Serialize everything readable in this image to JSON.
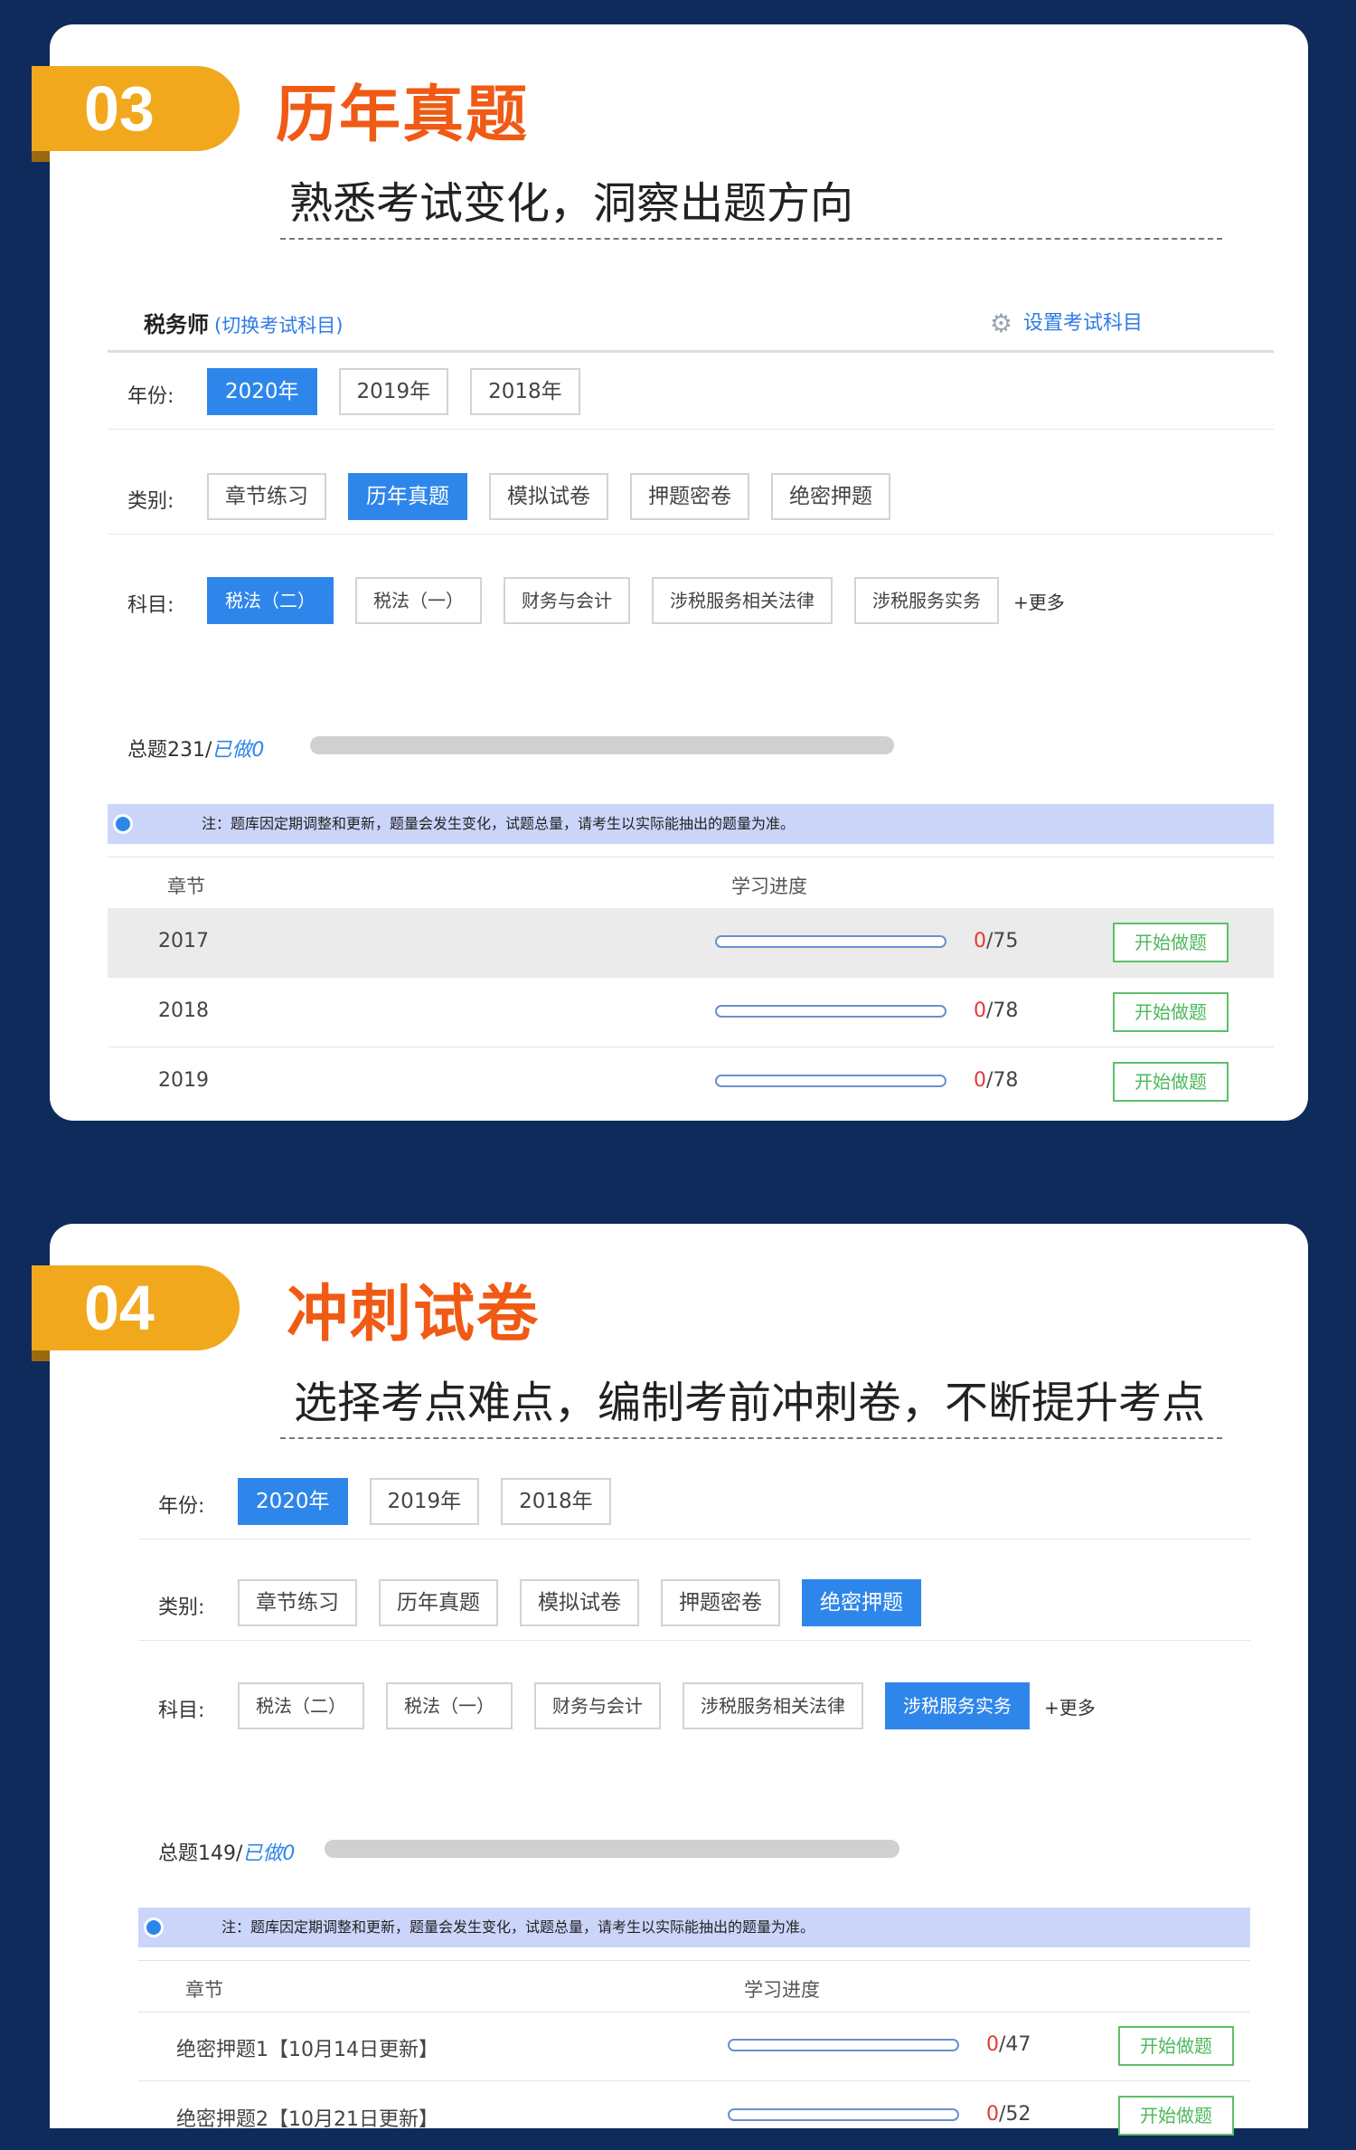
{
  "section3": {
    "number": "03",
    "title": "历年真题",
    "subtitle": "熟悉考试变化，洞察出题方向",
    "exam_name": "税务师",
    "switch_link": "(切换考试科目)",
    "settings_link": "设置考试科目",
    "year_label": "年份:",
    "years": [
      "2020年",
      "2019年",
      "2018年"
    ],
    "category_label": "类别:",
    "categories": [
      "章节练习",
      "历年真题",
      "模拟试卷",
      "押题密卷",
      "绝密押题"
    ],
    "subject_label": "科目:",
    "subjects": [
      "税法（二）",
      "税法（一）",
      "财务与会计",
      "涉税服务相关法律",
      "涉税服务实务"
    ],
    "more": "+更多",
    "total": "总题231/",
    "done": "已做0",
    "progress_fraction": 0,
    "note": "注：题库因定期调整和更新，题量会发生变化，试题总量，请考生以实际能抽出的题量为准。",
    "col_chapter": "章节",
    "col_progress": "学习进度",
    "rows": [
      {
        "name": "2017",
        "done": "0",
        "total": "/75",
        "progress": 0,
        "action": "开始做题"
      },
      {
        "name": "2018",
        "done": "0",
        "total": "/78",
        "progress": 0,
        "action": "开始做题"
      },
      {
        "name": "2019",
        "done": "0",
        "total": "/78",
        "progress": 0,
        "action": "开始做题"
      }
    ]
  },
  "section4": {
    "number": "04",
    "title": "冲刺试卷",
    "subtitle": "选择考点难点，编制考前冲刺卷，不断提升考点",
    "year_label": "年份:",
    "years": [
      "2020年",
      "2019年",
      "2018年"
    ],
    "category_label": "类别:",
    "categories": [
      "章节练习",
      "历年真题",
      "模拟试卷",
      "押题密卷",
      "绝密押题"
    ],
    "subject_label": "科目:",
    "subjects": [
      "税法（二）",
      "税法（一）",
      "财务与会计",
      "涉税服务相关法律",
      "涉税服务实务"
    ],
    "more": "+更多",
    "total": "总题149/",
    "done": "已做0",
    "progress_fraction": 0,
    "note": "注：题库因定期调整和更新，题量会发生变化，试题总量，请考生以实际能抽出的题量为准。",
    "col_chapter": "章节",
    "col_progress": "学习进度",
    "rows": [
      {
        "name": "绝密押题1【10月14日更新】",
        "done": "0",
        "total": "/47",
        "progress": 0,
        "action": "开始做题"
      },
      {
        "name": "绝密押题2【10月21日更新】",
        "done": "0",
        "total": "/52",
        "progress": 0,
        "action": "开始做题"
      }
    ]
  },
  "colors": {
    "background": "#0f2b5c",
    "badge": "#f2a81c",
    "title": "#f05a14",
    "accent_blue": "#2f86ea",
    "start_green": "#4db85c",
    "count_red": "#e53935"
  },
  "icons": {
    "settings": "gear-icon",
    "note": "info-dot-icon"
  }
}
